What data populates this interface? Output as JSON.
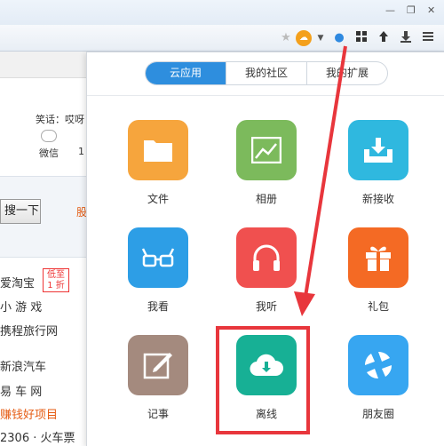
{
  "background_page": {
    "laugh_text": "笑话：哎呀",
    "weixin_label": "微信",
    "count_text": "1",
    "search_button": "搜一下",
    "orange_text": "股",
    "links": [
      {
        "text": "爱淘宝",
        "color": "normal"
      },
      {
        "text": "小 游 戏",
        "color": "normal"
      },
      {
        "text": "携程旅行网",
        "color": "normal"
      },
      {
        "text": "新浪汽车",
        "color": "normal"
      },
      {
        "text": "易 车 网",
        "color": "normal"
      },
      {
        "text": "赚钱好项目",
        "color": "red"
      },
      {
        "text": "2306 · 火车票",
        "color": "normal"
      }
    ],
    "badge_line1": "低至",
    "badge_line2": "1 折"
  },
  "popup": {
    "tabs": [
      "云应用",
      "我的社区",
      "我的扩展"
    ],
    "active_tab": "云应用",
    "apps": [
      {
        "label": "文件",
        "icon": "folder-icon",
        "color": "#f6a53d"
      },
      {
        "label": "相册",
        "icon": "photo-icon",
        "color": "#7cba5c"
      },
      {
        "label": "新接收",
        "icon": "inbox-download-icon",
        "color": "#2fb8df"
      },
      {
        "label": "我看",
        "icon": "glasses-icon",
        "color": "#2d9ee6"
      },
      {
        "label": "我听",
        "icon": "headphones-icon",
        "color": "#f0504f"
      },
      {
        "label": "礼包",
        "icon": "gift-icon",
        "color": "#f46a24"
      },
      {
        "label": "记事",
        "icon": "notepad-icon",
        "color": "#a48a7e"
      },
      {
        "label": "离线",
        "icon": "cloud-download-icon",
        "color": "#17b095"
      },
      {
        "label": "朋友圈",
        "icon": "friends-circle-icon",
        "color": "#37a6f1"
      }
    ],
    "highlighted_app": "离线"
  },
  "colors": {
    "accent": "#2e8ede",
    "annotation_red": "#e8363c"
  }
}
